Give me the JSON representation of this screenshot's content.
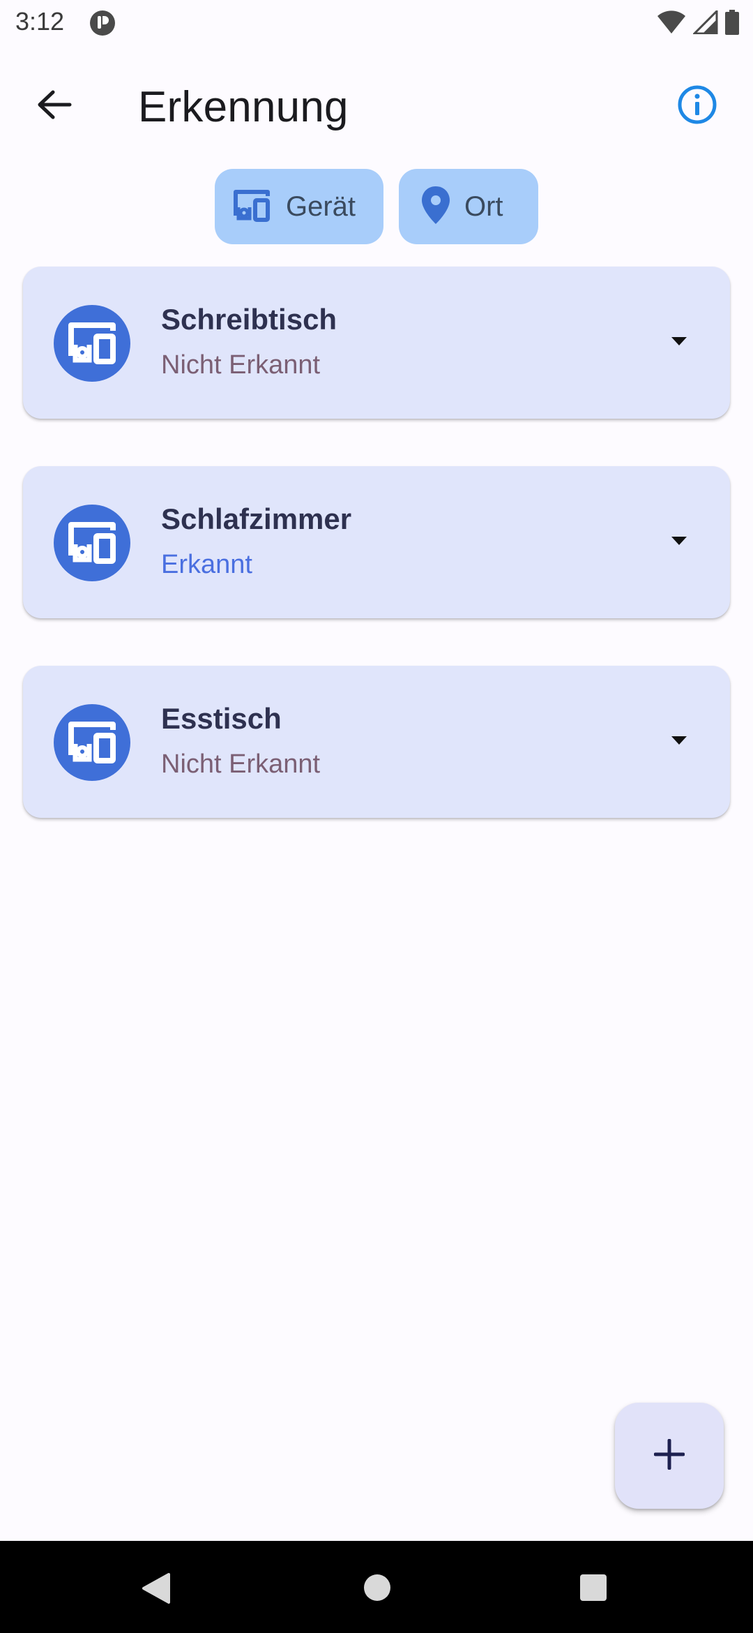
{
  "status_bar": {
    "time": "3:12",
    "icons": [
      "app-notification-icon",
      "wifi-icon",
      "cell-signal-icon",
      "battery-icon"
    ]
  },
  "app_bar": {
    "title": "Erkennung",
    "back_icon": "arrow-back-icon",
    "info_icon": "info-icon"
  },
  "filters": [
    {
      "label": "Gerät",
      "icon": "devices-icon"
    },
    {
      "label": "Ort",
      "icon": "location-pin-icon"
    }
  ],
  "devices": [
    {
      "name": "Schreibtisch",
      "status": "Nicht Erkannt",
      "detected": false
    },
    {
      "name": "Schlafzimmer",
      "status": "Erkannt",
      "detected": true
    },
    {
      "name": "Esstisch",
      "status": "Nicht Erkannt",
      "detected": false
    }
  ],
  "fab": {
    "icon": "add-icon"
  },
  "colors": {
    "background": "#fdfbff",
    "chip": "#a8cdfa",
    "card": "#e0e5fb",
    "avatar": "#3f6fd8",
    "status_detected": "#4a6fe0",
    "status_not_detected": "#7b5f74",
    "info_accent": "#1e88e5"
  }
}
